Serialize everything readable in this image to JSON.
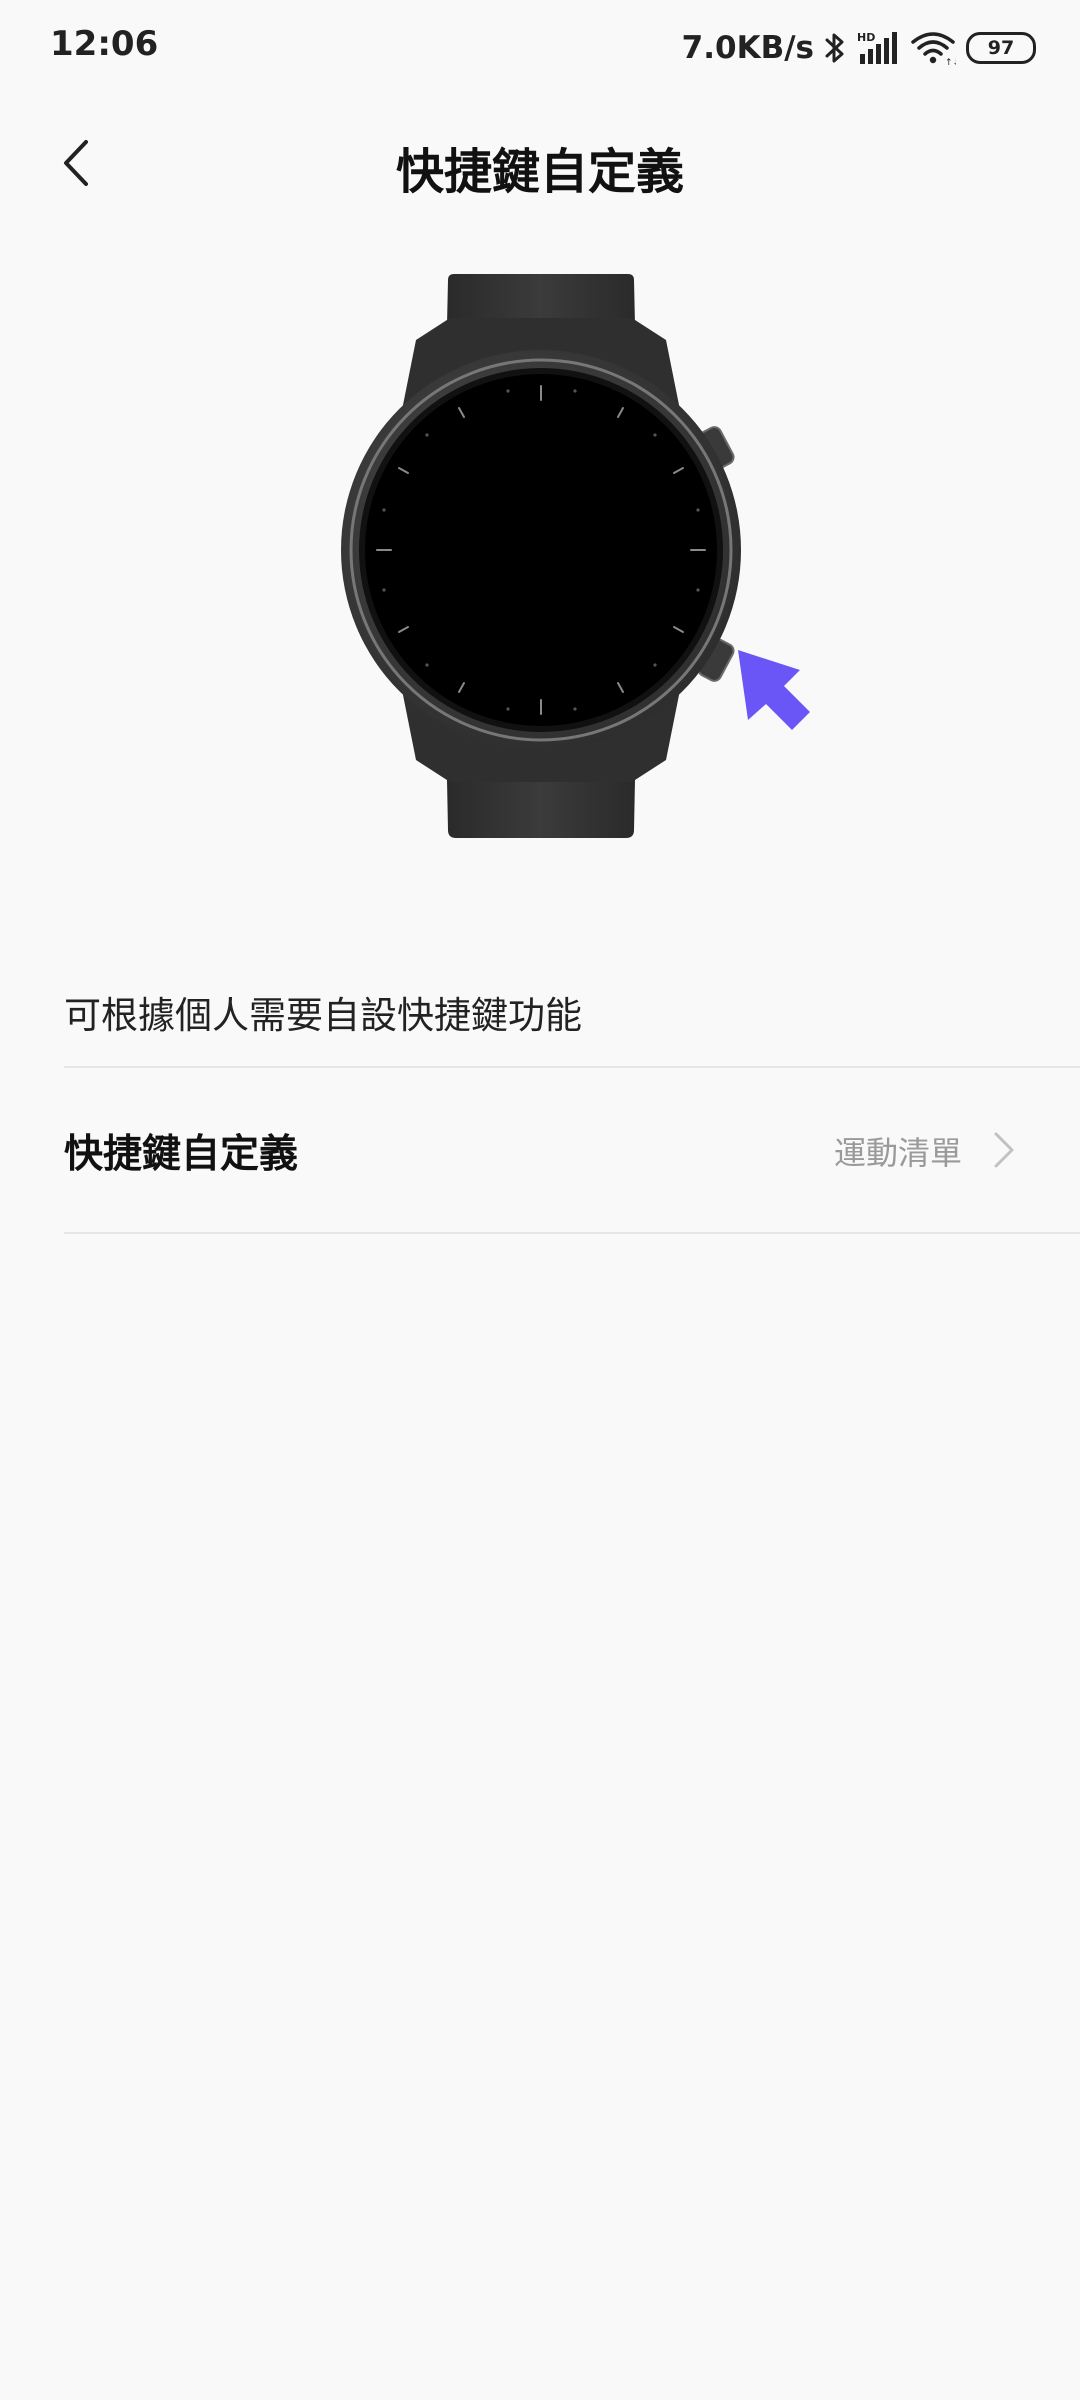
{
  "status_bar": {
    "time": "12:06",
    "net_speed": "7.0KB/s",
    "battery": "97",
    "icons": [
      "bluetooth-icon",
      "hd-signal-icon",
      "wifi-icon",
      "battery-icon"
    ]
  },
  "header": {
    "title": "快捷鍵自定義",
    "back_icon": "chevron-left-icon"
  },
  "illustration": {
    "name": "watch-with-button-indicator",
    "arrow_color": "#6a55f6"
  },
  "content": {
    "description": "可根據個人需要自設快捷鍵功能",
    "setting": {
      "label": "快捷鍵自定義",
      "value": "運動清單",
      "chevron_icon": "chevron-right-icon"
    }
  }
}
